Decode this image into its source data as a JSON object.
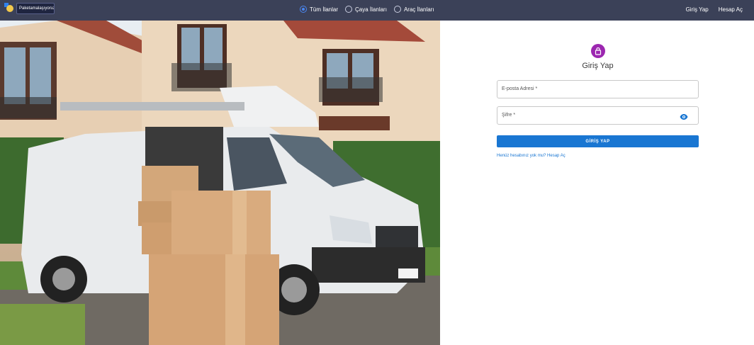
{
  "header": {
    "logo_text": "Paketamalaşıyoruz.",
    "filters": [
      {
        "label": "Tüm İlanlar",
        "selected": true
      },
      {
        "label": "Çaya İlanları",
        "selected": false
      },
      {
        "label": "Araç İlanları",
        "selected": false
      }
    ],
    "nav": {
      "login": "Giriş Yap",
      "register": "Hesap Aç"
    }
  },
  "login": {
    "title": "Giriş Yap",
    "email_label": "E-posta Adresi *",
    "password_label": "Şifre *",
    "submit_label": "GİRİŞ YAP",
    "register_link": "Henüz hesabınız yok mu? Hesap Aç"
  },
  "colors": {
    "topbar": "#3b4158",
    "accent": "#1976d2",
    "lock": "#9c27b0"
  }
}
